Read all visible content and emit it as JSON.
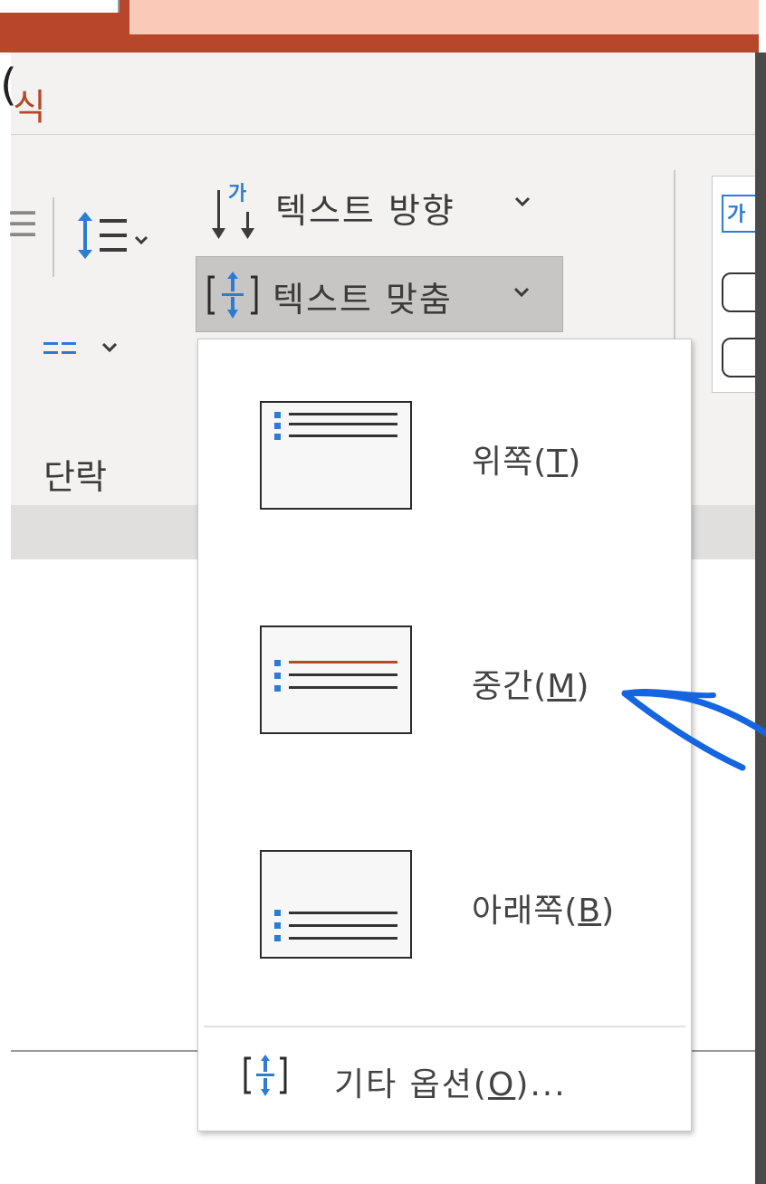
{
  "ribbon": {
    "tab_label": "식",
    "text_direction_label": "텍스트 방향",
    "text_align_label": "텍스트 맞춤",
    "paragraph_group_label": "단락",
    "direction_icon_glyph": "가",
    "shape_icon_glyph": "가"
  },
  "menu": {
    "items": [
      {
        "label_main": "위쪽(",
        "label_key": "T",
        "label_end": ")"
      },
      {
        "label_main": "중간(",
        "label_key": "M",
        "label_end": ")"
      },
      {
        "label_main": "아래쪽(",
        "label_key": "B",
        "label_end": ")"
      }
    ],
    "more_options_main": "기타 옵션(",
    "more_options_key": "O",
    "more_options_end": ")..."
  },
  "colors": {
    "accent": "#b7472a",
    "icon_blue": "#2b7cd3",
    "annotation": "#1565e0"
  }
}
